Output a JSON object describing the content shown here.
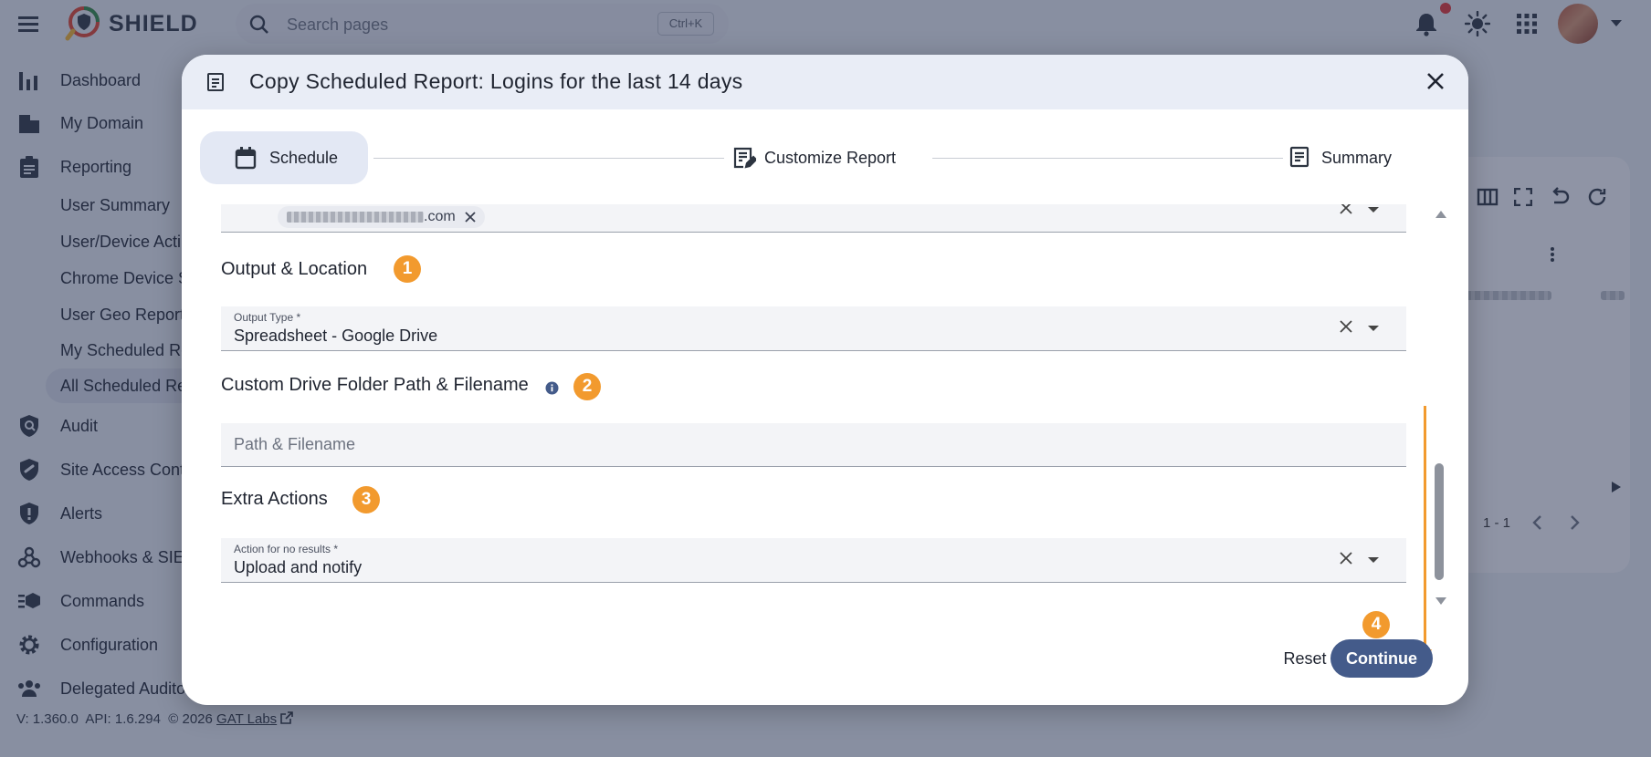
{
  "app": {
    "brand": "SHIELD"
  },
  "search": {
    "placeholder": "Search pages",
    "shortcut": "Ctrl+K"
  },
  "sidebar": {
    "items": [
      {
        "label": "Dashboard",
        "icon": "bar-chart-icon"
      },
      {
        "label": "My Domain",
        "icon": "building-icon"
      },
      {
        "label": "Reporting",
        "icon": "clipboard-icon"
      },
      {
        "label": "Audit",
        "icon": "shield-search-icon"
      },
      {
        "label": "Site Access Cont",
        "icon": "shield-link-icon"
      },
      {
        "label": "Alerts",
        "icon": "shield-alert-icon"
      },
      {
        "label": "Webhooks & SIEM",
        "icon": "webhook-icon"
      },
      {
        "label": "Commands",
        "icon": "commands-icon"
      },
      {
        "label": "Configuration",
        "icon": "gear-icon"
      },
      {
        "label": "Delegated Audito",
        "icon": "people-icon"
      }
    ],
    "reporting_sub": [
      "User Summary",
      "User/Device Acti",
      "Chrome Device S",
      "User Geo Report",
      "My Scheduled Re",
      "All Scheduled Re"
    ]
  },
  "background_panel": {
    "pagination": "1 - 1"
  },
  "footer": {
    "version": "V: 1.360.0",
    "api": "API: 1.6.294",
    "copyright": "© 2026",
    "link": "GAT Labs"
  },
  "modal": {
    "title": "Copy Scheduled Report: Logins for the last 14 days",
    "steps": [
      "Schedule",
      "Customize Report",
      "Summary"
    ],
    "recipient_chip_suffix": ".com",
    "sections": {
      "output": {
        "title": "Output & Location",
        "badge": "1"
      },
      "drive": {
        "title": "Custom Drive Folder Path & Filename",
        "badge": "2"
      },
      "extra": {
        "title": "Extra Actions",
        "badge": "3"
      }
    },
    "output_type": {
      "label": "Output Type *",
      "value": "Spreadsheet - Google Drive"
    },
    "path_input": {
      "placeholder": "Path & Filename",
      "value": ""
    },
    "no_results": {
      "label": "Action for no results *",
      "value": "Upload and notify"
    },
    "continue_badge": "4",
    "buttons": {
      "reset": "Reset",
      "continue": "Continue"
    }
  },
  "colors": {
    "accent": "#445b8a",
    "highlight": "#f29a2e",
    "notification": "#e33232"
  }
}
